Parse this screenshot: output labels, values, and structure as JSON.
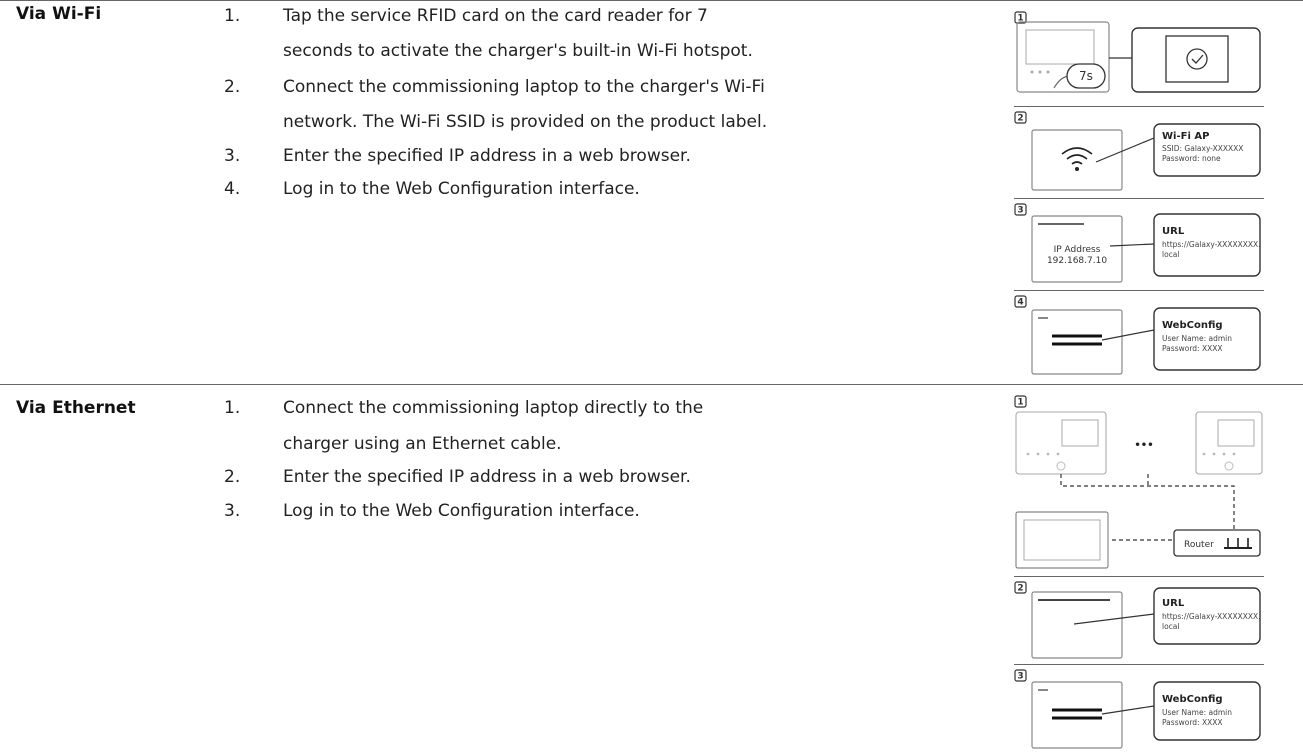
{
  "sections": [
    {
      "heading": "Via Wi-Fi",
      "steps": [
        {
          "num": "1.",
          "lines": [
            "Tap the service RFID card on the card reader for 7",
            "seconds to activate the charger's built-in Wi-Fi hotspot."
          ]
        },
        {
          "num": "2.",
          "lines": [
            "Connect the commissioning laptop to the charger's Wi-Fi",
            "network. The Wi-Fi SSID is provided on the product label."
          ]
        },
        {
          "num": "3.",
          "lines": [
            "Enter the specified IP address in a web browser."
          ]
        },
        {
          "num": "4.",
          "lines": [
            "Log in to the Web Configuration interface."
          ]
        }
      ],
      "panels": [
        {
          "badge": "1",
          "timer": "7s"
        },
        {
          "badge": "2",
          "title": "Wi-Fi AP",
          "lines": [
            "SSID: Galaxy-XXXXXX",
            "Password: none"
          ]
        },
        {
          "badge": "3",
          "screen": [
            "IP Address",
            "192.168.7.10"
          ],
          "title": "URL",
          "lines": [
            "https://Galaxy-XXXXXXXX.",
            "local"
          ]
        },
        {
          "badge": "4",
          "title": "WebConfig",
          "lines": [
            "User Name: admin",
            "Password: XXXX"
          ]
        }
      ]
    },
    {
      "heading": "Via Ethernet",
      "steps": [
        {
          "num": "1.",
          "lines": [
            "Connect the commissioning laptop directly to the",
            "charger using an Ethernet cable."
          ]
        },
        {
          "num": "2.",
          "lines": [
            "Enter the specified IP address in a web browser."
          ]
        },
        {
          "num": "3.",
          "lines": [
            "Log in to the Web Configuration interface."
          ]
        }
      ],
      "panels": [
        {
          "badge": "1",
          "ellipsis": "•••",
          "router": "Router"
        },
        {
          "badge": "2",
          "title": "URL",
          "lines": [
            "https://Galaxy-XXXXXXXX.",
            "local"
          ]
        },
        {
          "badge": "3",
          "title": "WebConfig",
          "lines": [
            "User Name: admin",
            "Password: XXXX"
          ]
        }
      ]
    }
  ]
}
